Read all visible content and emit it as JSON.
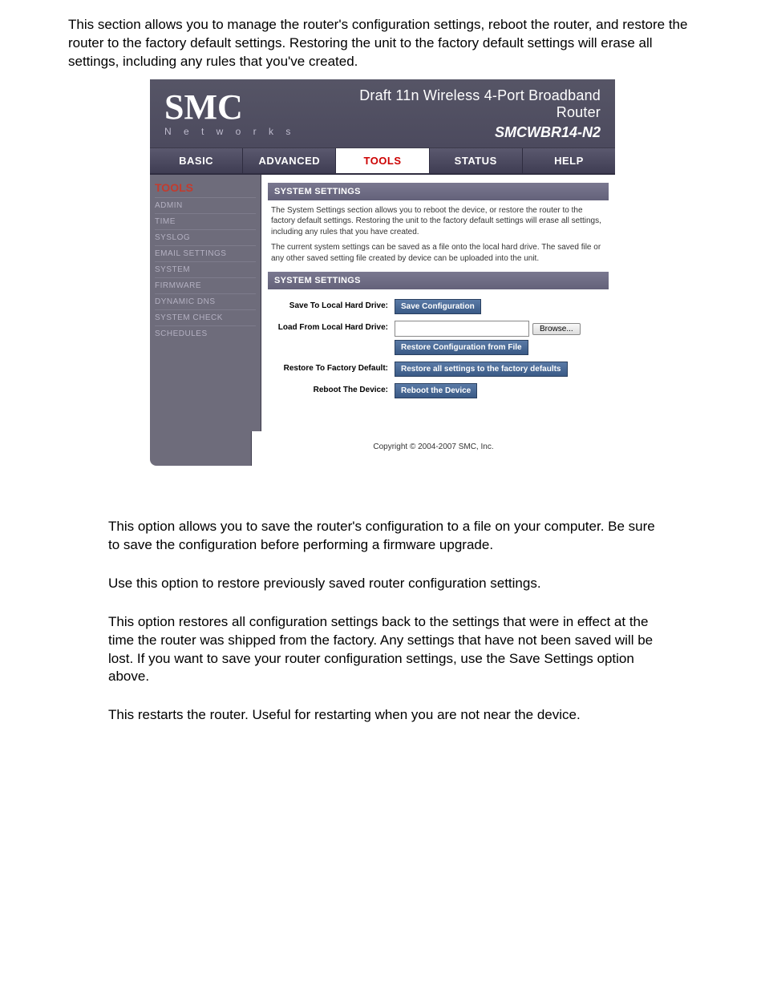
{
  "intro": "This section allows you to manage the router's configuration settings, reboot the router, and restore the router to the factory default settings. Restoring the unit to the factory default settings will erase all settings, including any rules that you've created.",
  "router": {
    "brand": "SMC",
    "brand_sub": "N e t w o r k s",
    "title_line1": "Draft 11n Wireless 4-Port Broadband Router",
    "title_line2": "SMCWBR14-N2",
    "nav": {
      "basic": "BASIC",
      "advanced": "ADVANCED",
      "tools": "TOOLS",
      "status": "STATUS",
      "help": "HELP"
    },
    "sidebar": {
      "title": "TOOLS",
      "items": [
        "ADMIN",
        "TIME",
        "SYSLOG",
        "EMAIL SETTINGS",
        "SYSTEM",
        "FIRMWARE",
        "DYNAMIC DNS",
        "SYSTEM CHECK",
        "SCHEDULES"
      ]
    },
    "section1": {
      "header": "SYSTEM SETTINGS",
      "desc1": "The System Settings section allows you to reboot the device, or restore the router to the factory default settings. Restoring the unit to the factory default settings will erase all settings, including any rules that you have created.",
      "desc2": "The current system settings can be saved as a file onto the local hard drive. The saved file or any other saved setting file created by device can be uploaded into the unit."
    },
    "section2": {
      "header": "SYSTEM SETTINGS",
      "rows": {
        "save_label": "Save To Local Hard Drive:",
        "save_btn": "Save Configuration",
        "load_label": "Load From Local Hard Drive:",
        "browse_btn": "Browse...",
        "restore_file_btn": "Restore Configuration from File",
        "factory_label": "Restore To Factory Default:",
        "factory_btn": "Restore all settings to the factory defaults",
        "reboot_label": "Reboot The Device:",
        "reboot_btn": "Reboot the Device"
      }
    },
    "copyright": "Copyright © 2004-2007 SMC, Inc."
  },
  "outro": {
    "p1": "This option allows you to save the router's configuration to a file on your computer. Be sure to save the configuration before performing a firmware upgrade.",
    "p2": "Use this option to restore previously saved router configuration settings.",
    "p3": "This option restores all configuration settings back to the settings that were in effect at the time the router was shipped from the factory. Any settings that have not been saved will be lost. If you want to save your router configuration settings, use the Save Settings option above.",
    "p4": "This restarts the router. Useful for restarting when you are not near the device."
  }
}
